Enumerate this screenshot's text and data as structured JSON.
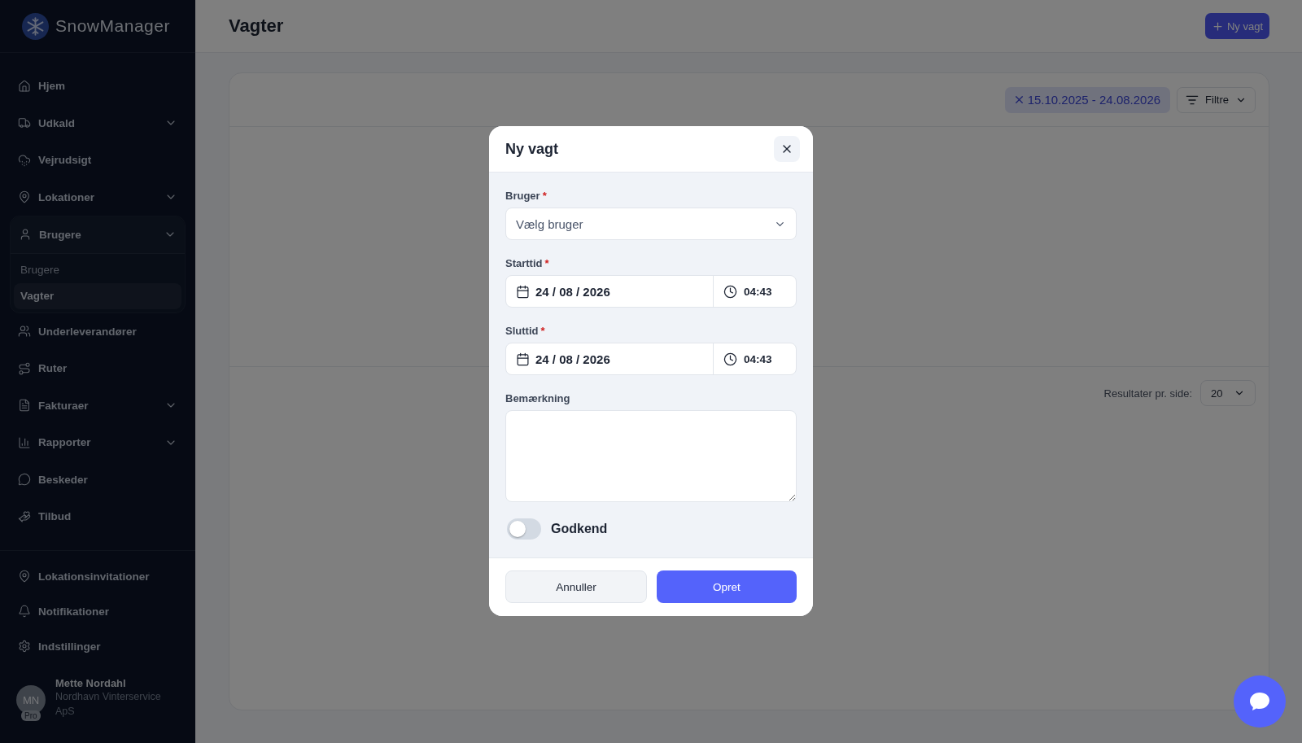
{
  "sidebar": {
    "logo": "SnowManager",
    "items": [
      {
        "label": "Hjem"
      },
      {
        "label": "Udkald",
        "expanded": false
      },
      {
        "label": "Vejrudsigt"
      },
      {
        "label": "Lokationer",
        "expanded": false
      },
      {
        "label": "Brugere",
        "expanded": true,
        "children": [
          {
            "label": "Brugere",
            "selected": false
          },
          {
            "label": "Vagter",
            "selected": true
          }
        ]
      },
      {
        "label": "Underleverandører"
      },
      {
        "label": "Ruter"
      },
      {
        "label": "Fakturaer",
        "expanded": false
      },
      {
        "label": "Rapporter",
        "expanded": false
      },
      {
        "label": "Beskeder"
      },
      {
        "label": "Tilbud"
      }
    ],
    "bottom_items": [
      {
        "label": "Lokationsinvitationer"
      },
      {
        "label": "Notifikationer"
      },
      {
        "label": "Indstillinger"
      }
    ],
    "user": {
      "initials": "MN",
      "badge": "Pro",
      "name": "Mette Nordahl",
      "company": "Nordhavn Vinterservice ApS"
    }
  },
  "header": {
    "title": "Vagter",
    "button": "Ny vagt"
  },
  "card": {
    "date_filter": "15.10.2025 - 24.08.2026",
    "filter_button": "Filtre",
    "per_page_label": "Resultater pr. side:",
    "per_page": "20"
  },
  "dialog": {
    "title": "Ny vagt",
    "fields": [
      {
        "kind": "select",
        "label": "Bruger",
        "required_mark": "*",
        "placeholder": "Vælg bruger"
      },
      {
        "kind": "datetime",
        "label": "Starttid",
        "required_mark": "*",
        "date": "24 / 08 / 2026",
        "time": "04:43"
      },
      {
        "kind": "datetime",
        "label": "Sluttid",
        "required_mark": "*",
        "date": "24 / 08 / 2026",
        "time": "04:43"
      },
      {
        "kind": "textarea",
        "label": "Bemærkning"
      }
    ],
    "toggle": {
      "label": "Godkend",
      "on": false
    },
    "buttons": [
      {
        "label": "Annuller",
        "kind": "secondary"
      },
      {
        "label": "Opret",
        "kind": "primary"
      }
    ]
  }
}
